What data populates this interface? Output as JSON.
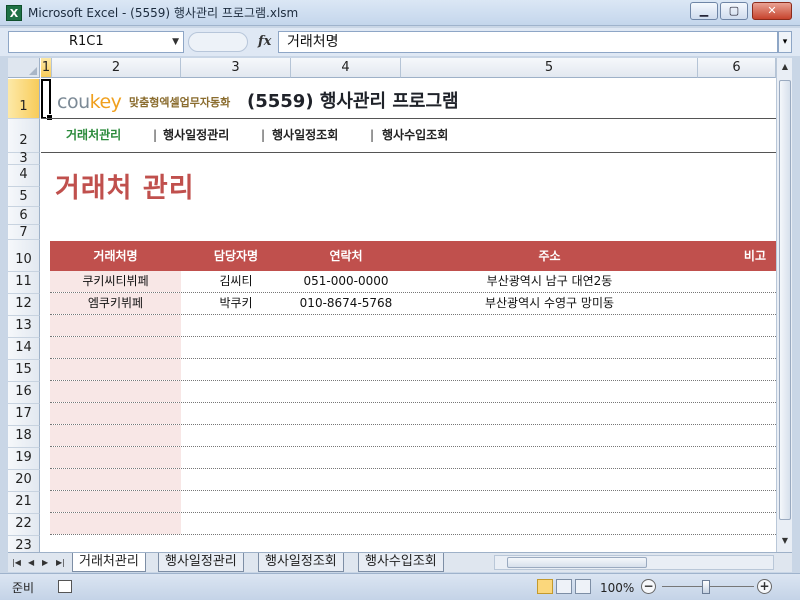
{
  "window": {
    "title": "Microsoft Excel - (5559) 행사관리 프로그램.xlsm",
    "app_icon": "X",
    "buttons": {
      "minimize": "▁",
      "maximize": "▢",
      "close": "✕"
    }
  },
  "formula_bar": {
    "name_box": "R1C1",
    "fx": "fx",
    "content": "거래처명"
  },
  "columns": [
    "1",
    "2",
    "3",
    "4",
    "5",
    "6"
  ],
  "rows": [
    "1",
    "2",
    "3",
    "4",
    "5",
    "6",
    "7",
    "10",
    "11",
    "12",
    "13",
    "14",
    "15",
    "16",
    "17",
    "18",
    "19",
    "20",
    "21",
    "22",
    "23"
  ],
  "header": {
    "logo_main": "cou",
    "logo_accent": "key",
    "logo_sub": "맞춤형엑셀업무자동화",
    "program_title": "(5559) 행사관리 프로그램"
  },
  "nav": {
    "items": [
      "거래처관리",
      "행사일정관리",
      "행사일정조회",
      "행사수입조회"
    ],
    "separator": "|",
    "current_color": "#2a8a3a"
  },
  "page_heading": "거래처 관리",
  "table": {
    "header_color": "#c0504d",
    "columns": [
      "거래처명",
      "담당자명",
      "연락처",
      "주소",
      "비고"
    ],
    "rows": [
      [
        "쿠키씨티뷔페",
        "김씨티",
        "051-000-0000",
        "부산광역시 남구 대연2동",
        ""
      ],
      [
        "엠쿠키뷔페",
        "박쿠키",
        "010-8674-5768",
        "부산광역시 수영구 망미동",
        ""
      ],
      [
        "",
        "",
        "",
        "",
        ""
      ],
      [
        "",
        "",
        "",
        "",
        ""
      ],
      [
        "",
        "",
        "",
        "",
        ""
      ],
      [
        "",
        "",
        "",
        "",
        ""
      ],
      [
        "",
        "",
        "",
        "",
        ""
      ],
      [
        "",
        "",
        "",
        "",
        ""
      ],
      [
        "",
        "",
        "",
        "",
        ""
      ],
      [
        "",
        "",
        "",
        "",
        ""
      ],
      [
        "",
        "",
        "",
        "",
        ""
      ],
      [
        "",
        "",
        "",
        "",
        ""
      ]
    ]
  },
  "sheet_tabs": [
    "거래처관리",
    "행사일정관리",
    "행사일정조회",
    "행사수입조회"
  ],
  "status": {
    "ready": "준비",
    "zoom": "100%",
    "zoom_level_percent": 100
  }
}
